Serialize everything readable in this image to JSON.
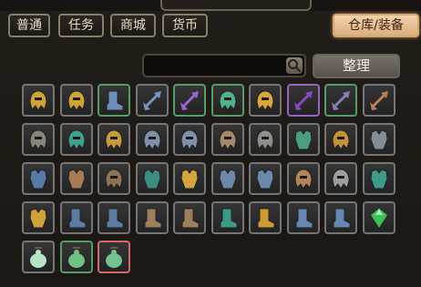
{
  "tabs": [
    {
      "id": "normal",
      "label": "普通",
      "active": false
    },
    {
      "id": "quest",
      "label": "任务",
      "active": false
    },
    {
      "id": "shop",
      "label": "商城",
      "active": false
    },
    {
      "id": "currency",
      "label": "货币",
      "active": false
    },
    {
      "id": "warehouse",
      "label": "仓库/装备",
      "active": true
    }
  ],
  "search": {
    "placeholder": "",
    "icon": "search-icon"
  },
  "sort_button": {
    "label": "整理"
  },
  "colors": {
    "accent": "#dcaf7c",
    "border_default": "#757575",
    "border_green": "#5a9a67",
    "border_purple": "#9a62c2",
    "border_red": "#d26a6a"
  },
  "inventory": {
    "rows": [
      [
        {
          "icon": "gold-helmet-icon",
          "rarity": "normal",
          "color": "#d0a23a"
        },
        {
          "icon": "gold-helmet-icon",
          "rarity": "normal",
          "color": "#d0a23a"
        },
        {
          "icon": "blue-boots-icon",
          "rarity": "green",
          "color": "#6f8db9"
        },
        {
          "icon": "twin-axes-icon",
          "rarity": "normal",
          "color": "#7c95c2"
        },
        {
          "icon": "purple-axes-icon",
          "rarity": "green",
          "color": "#9c64cf"
        },
        {
          "icon": "green-gear-icon",
          "rarity": "green",
          "color": "#4fb288"
        },
        {
          "icon": "gold-ornament-icon",
          "rarity": "normal",
          "color": "#d6a93d"
        },
        {
          "icon": "purple-blade-icon",
          "rarity": "purple",
          "color": "#8b4ac5"
        },
        {
          "icon": "purple-blade-icon",
          "rarity": "green",
          "color": "#8e7db5"
        },
        {
          "icon": "bronze-blade-icon",
          "rarity": "normal",
          "color": "#b8805a"
        }
      ],
      [
        {
          "icon": "stone-helmet-icon",
          "rarity": "normal",
          "color": "#8a857b"
        },
        {
          "icon": "teal-hat-icon",
          "rarity": "normal",
          "color": "#3ea28a"
        },
        {
          "icon": "gold-visor-icon",
          "rarity": "normal",
          "color": "#c79a3a"
        },
        {
          "icon": "steel-helmet-icon",
          "rarity": "normal",
          "color": "#7e90aa"
        },
        {
          "icon": "steel-helmet-icon",
          "rarity": "normal",
          "color": "#7e90aa"
        },
        {
          "icon": "bronze-mask-icon",
          "rarity": "normal",
          "color": "#a8886a"
        },
        {
          "icon": "grey-mask-icon",
          "rarity": "normal",
          "color": "#8f8f8a"
        },
        {
          "icon": "green-armor-icon",
          "rarity": "normal",
          "color": "#4b9d7d"
        },
        {
          "icon": "gold-helm-icon",
          "rarity": "normal",
          "color": "#c19334"
        },
        {
          "icon": "grey-armor-icon",
          "rarity": "normal",
          "color": "#858d96"
        }
      ],
      [
        {
          "icon": "blue-armor-icon",
          "rarity": "normal",
          "color": "#5679a6"
        },
        {
          "icon": "bronze-plate-icon",
          "rarity": "normal",
          "color": "#a67b55"
        },
        {
          "icon": "demon-helm-icon",
          "rarity": "normal",
          "color": "#8d7358"
        },
        {
          "icon": "teal-plate-icon",
          "rarity": "normal",
          "color": "#3c8d81"
        },
        {
          "icon": "gold-plate-icon",
          "rarity": "normal",
          "color": "#d3a43f"
        },
        {
          "icon": "steel-plate-icon",
          "rarity": "normal",
          "color": "#6c88aa"
        },
        {
          "icon": "steel-plate-icon",
          "rarity": "normal",
          "color": "#6c88aa"
        },
        {
          "icon": "bronze-visor-icon",
          "rarity": "normal",
          "color": "#b0865a"
        },
        {
          "icon": "grey-helm-icon",
          "rarity": "normal",
          "color": "#9b9d9e"
        },
        {
          "icon": "teal-chest-icon",
          "rarity": "normal",
          "color": "#3e9b8c"
        }
      ],
      [
        {
          "icon": "gold-gauntlet-icon",
          "rarity": "normal",
          "color": "#d1a13b"
        },
        {
          "icon": "steel-boots-icon",
          "rarity": "normal",
          "color": "#5c7ba1"
        },
        {
          "icon": "steel-boots-icon",
          "rarity": "normal",
          "color": "#5c7ba1"
        },
        {
          "icon": "bronze-boot-icon",
          "rarity": "normal",
          "color": "#9d7e5d"
        },
        {
          "icon": "bronze-boot-icon",
          "rarity": "normal",
          "color": "#9d7e5d"
        },
        {
          "icon": "teal-boot-icon",
          "rarity": "normal",
          "color": "#3a9a85"
        },
        {
          "icon": "gold-boot-icon",
          "rarity": "normal",
          "color": "#cf9c34"
        },
        {
          "icon": "steel-greave-icon",
          "rarity": "normal",
          "color": "#6587b0"
        },
        {
          "icon": "steel-greave-icon",
          "rarity": "normal",
          "color": "#6587b0"
        },
        {
          "icon": "emerald-gem-icon",
          "rarity": "normal",
          "color": "#3fbf5b"
        }
      ],
      [
        {
          "icon": "pale-gourd-icon",
          "rarity": "normal",
          "color": "#b7e4c6"
        },
        {
          "icon": "green-gourd-icon",
          "rarity": "green",
          "color": "#6fc183"
        },
        {
          "icon": "green-gourd-icon",
          "rarity": "red",
          "color": "#74c28e"
        }
      ]
    ]
  }
}
